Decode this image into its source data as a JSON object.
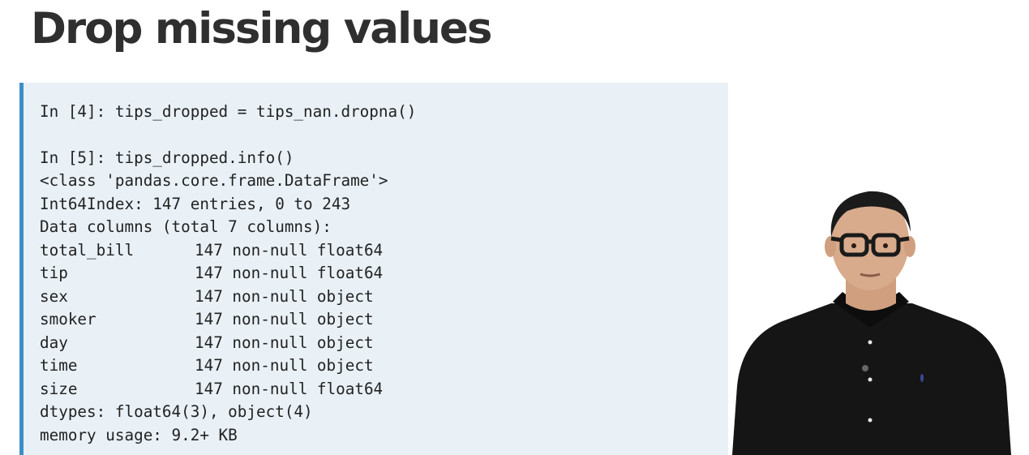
{
  "title": "Drop missing values",
  "code": {
    "cmd1": "In [4]: tips_dropped = tips_nan.dropna()",
    "cmd2": "In [5]: tips_dropped.info()",
    "class_line": "<class 'pandas.core.frame.DataFrame'>",
    "index_line": "Int64Index: 147 entries, 0 to 243",
    "data_columns_line": "Data columns (total 7 columns):",
    "columns": [
      {
        "name": "total_bill",
        "info": "147 non-null float64"
      },
      {
        "name": "tip",
        "info": "147 non-null float64"
      },
      {
        "name": "sex",
        "info": "147 non-null object"
      },
      {
        "name": "smoker",
        "info": "147 non-null object"
      },
      {
        "name": "day",
        "info": "147 non-null object"
      },
      {
        "name": "time",
        "info": "147 non-null object"
      },
      {
        "name": "size",
        "info": "147 non-null float64"
      }
    ],
    "dtypes_line": "dtypes: float64(3), object(4)",
    "memory_line": "memory usage: 9.2+ KB"
  },
  "colors": {
    "code_background": "#e9f1f7",
    "code_accent": "#3c8fc7",
    "title_text": "#2f2f2f"
  }
}
